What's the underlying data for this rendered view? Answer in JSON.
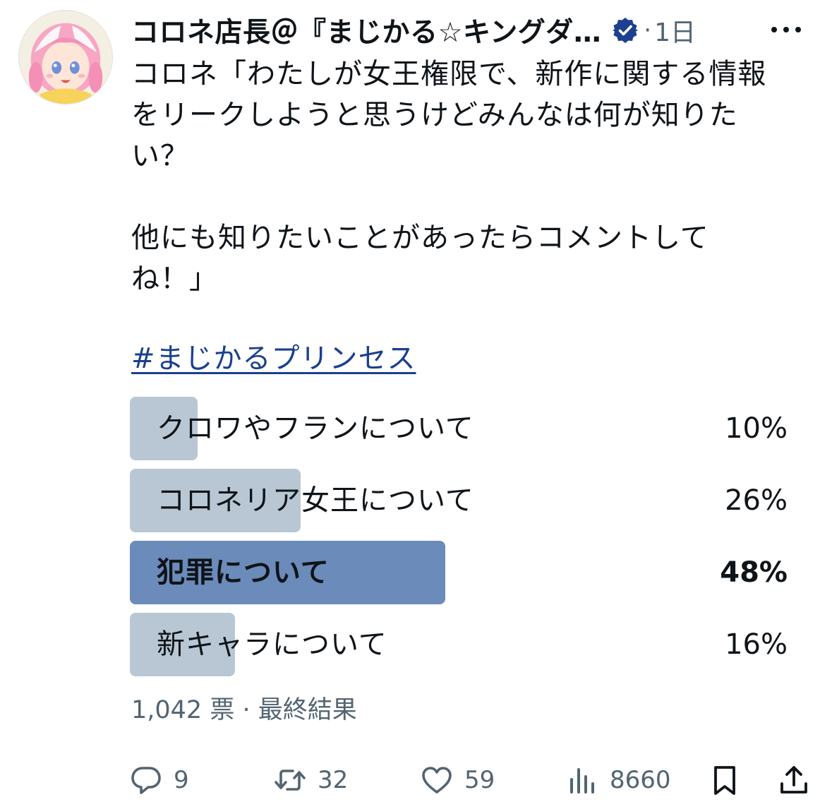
{
  "author": {
    "display_name": "コロネ店長＠『まじかる☆キングダ…",
    "timestamp": "1日",
    "separator": "·"
  },
  "tweet": {
    "lines": [
      "コロネ「わたしが女王権限で、新作に関する情報",
      "をリークしようと思うけどみんなは何が知りた",
      "い？",
      "",
      "他にも知りたいことがあったらコメントして",
      "ね！」"
    ],
    "hashtag": "#まじかるプリンセス"
  },
  "poll": {
    "options": [
      {
        "label": "クロワやフランについて",
        "percent_text": "10%",
        "percent": 10,
        "winner": false
      },
      {
        "label": "コロネリア女王について",
        "percent_text": "26%",
        "percent": 26,
        "winner": false
      },
      {
        "label": "犯罪について",
        "percent_text": "48%",
        "percent": 48,
        "winner": true
      },
      {
        "label": "新キャラについて",
        "percent_text": "16%",
        "percent": 16,
        "winner": false
      }
    ],
    "votes": "1,042 票",
    "meta_separator": "·",
    "status": "最終結果"
  },
  "actions": {
    "reply_count": "9",
    "retweet_count": "32",
    "like_count": "59",
    "view_count": "8660"
  },
  "icons": {
    "verified": "verified-badge-icon",
    "more": "more-options-icon",
    "reply": "reply-icon",
    "retweet": "retweet-icon",
    "like": "heart-icon",
    "views": "views-chart-icon",
    "bookmark": "bookmark-icon",
    "share": "share-icon"
  },
  "colors": {
    "text": "#0f1419",
    "secondary_text": "#536471",
    "hashtag": "#1a3f8f",
    "verified": "#1d3f8f",
    "poll_bar": "#b8c7d3",
    "poll_bar_winner": "#6b8bba"
  }
}
